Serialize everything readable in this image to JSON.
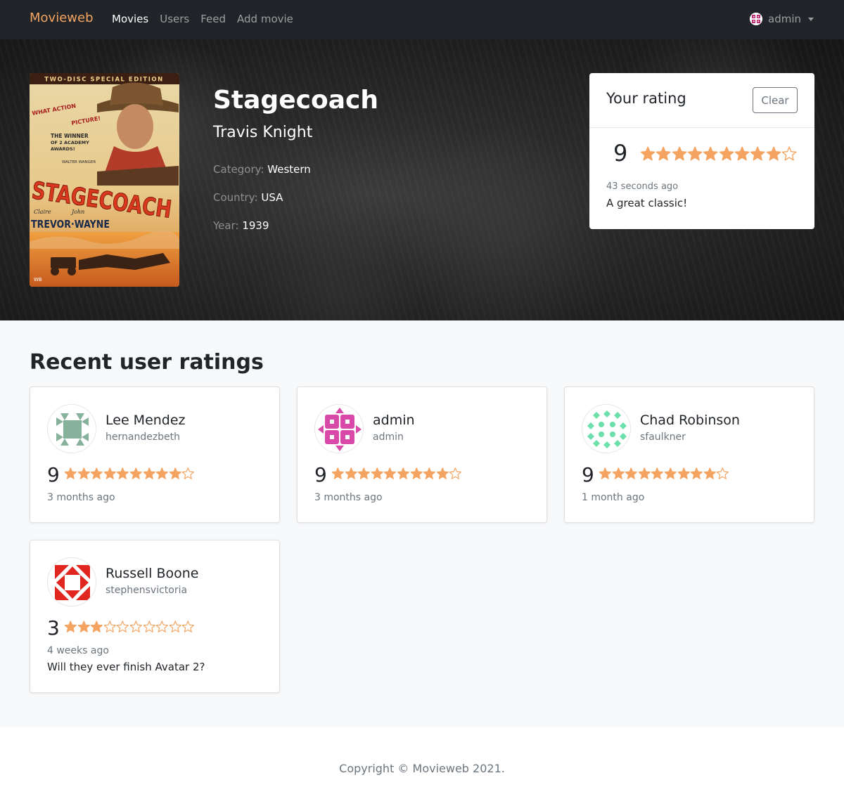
{
  "nav": {
    "brand": "Movieweb",
    "links": [
      {
        "label": "Movies",
        "active": true
      },
      {
        "label": "Users",
        "active": false
      },
      {
        "label": "Feed",
        "active": false
      },
      {
        "label": "Add movie",
        "active": false
      }
    ],
    "user": {
      "name": "admin",
      "avatar_color": "#c2307a"
    }
  },
  "movie": {
    "title": "Stagecoach",
    "director": "Travis Knight",
    "category_label": "Category:",
    "category": "Western",
    "country_label": "Country:",
    "country": "USA",
    "year_label": "Year:",
    "year": "1939",
    "poster": {
      "top_banner": "TWO-DISC SPECIAL EDITION",
      "tag1": "WHAT ACTION PICTURE!",
      "tag2": "THE WINNER OF 2 ACADEMY AWARDS!",
      "presenter": "WALTER WANGER presents",
      "title": "STAGECOACH",
      "actor1": "Claire TREVOR",
      "actor2": "John WAYNE"
    }
  },
  "your_rating": {
    "title": "Your rating",
    "clear_label": "Clear",
    "score": "9",
    "stars": 9,
    "max_stars": 10,
    "time": "43 seconds ago",
    "comment": "A great classic!"
  },
  "recent": {
    "title": "Recent user ratings",
    "ratings": [
      {
        "name": "Lee Mendez",
        "handle": "hernandezbeth",
        "score": "9",
        "stars": 9,
        "time": "3 months ago",
        "comment": "",
        "avatar_color": "#86b19a"
      },
      {
        "name": "admin",
        "handle": "admin",
        "score": "9",
        "stars": 9,
        "time": "3 months ago",
        "comment": "",
        "avatar_color": "#d94aa8"
      },
      {
        "name": "Chad Robinson",
        "handle": "sfaulkner",
        "score": "9",
        "stars": 9,
        "time": "1 month ago",
        "comment": "",
        "avatar_color": "#6be0aa"
      },
      {
        "name": "Russell Boone",
        "handle": "stephensvictoria",
        "score": "3",
        "stars": 3,
        "time": "4 weeks ago",
        "comment": "Will they ever finish Avatar 2?",
        "avatar_color": "#e0261e"
      }
    ]
  },
  "footer": {
    "copyright": "Copyright © Movieweb 2021."
  },
  "colors": {
    "star": "#f4a460",
    "brand": "#f4a460"
  }
}
